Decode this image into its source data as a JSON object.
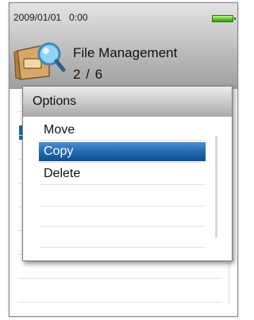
{
  "status": {
    "datetime": "2009/01/01   0:00",
    "battery_icon": "battery-full-icon"
  },
  "header": {
    "icon": "file-search-icon",
    "title": "File Management",
    "counter": "2 / 6"
  },
  "dialog": {
    "title": "Options",
    "options": [
      {
        "label": "Move",
        "selected": false
      },
      {
        "label": "Copy",
        "selected": true
      },
      {
        "label": "Delete",
        "selected": false
      }
    ]
  },
  "colors": {
    "selection": "#1e67ad",
    "battery": "#71c93a"
  }
}
